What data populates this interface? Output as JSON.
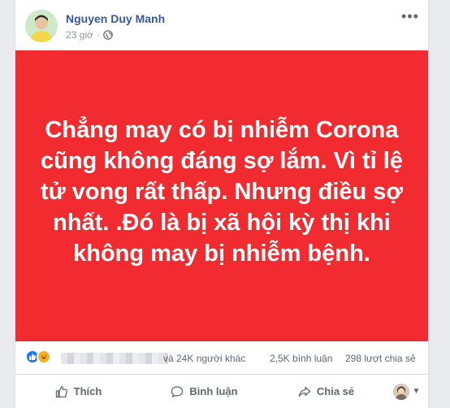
{
  "post": {
    "author": "Nguyen Duy Manh",
    "time": "23 giờ",
    "separator": "·",
    "privacy_icon": "globe-icon",
    "more_icon": "more-dots-icon",
    "banner_text": "Chẳng may có bị nhiễm Corona cũng không đáng sợ lắm. Vì tỉ lệ tử vong rất thấp. Nhưng điều sợ nhất. .Đó là bị xã hội kỳ thị khi không may bị nhiễm bệnh.",
    "banner_color": "#f12b30"
  },
  "stats": {
    "reaction_icons": [
      "like-reaction-icon",
      "haha-reaction-icon"
    ],
    "others": "và 24K người khác",
    "comments": "2,5K bình luận",
    "shares": "298 lượt chia sẻ"
  },
  "actions": {
    "like": "Thích",
    "comment": "Bình luận",
    "share": "Chia sẻ"
  },
  "colors": {
    "link": "#385898",
    "muted": "#606770",
    "like_blue": "#1877f2",
    "haha_yellow": "#f7b125"
  }
}
